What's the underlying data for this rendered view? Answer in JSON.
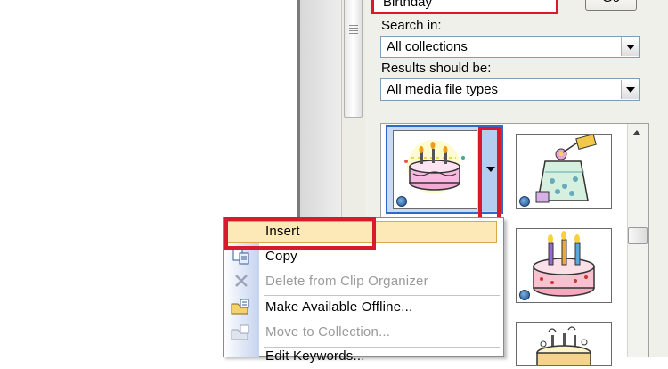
{
  "search": {
    "value": "Birthday",
    "go_label": "Go"
  },
  "search_in": {
    "label": "Search in:",
    "value": "All collections"
  },
  "results_type": {
    "label": "Results should be:",
    "value": "All media file types"
  },
  "context_menu": {
    "items": [
      {
        "label": "Insert",
        "enabled": true
      },
      {
        "label": "Copy",
        "enabled": true
      },
      {
        "label": "Delete from Clip Organizer",
        "enabled": false
      },
      {
        "label": "Make Available Offline...",
        "enabled": true
      },
      {
        "label": "Move to Collection...",
        "enabled": false
      },
      {
        "label": "Edit Keywords...",
        "enabled": true
      }
    ]
  },
  "clips": [
    {
      "name": "birthday-cake-clip",
      "icon": "cake-with-candles"
    },
    {
      "name": "gift-vase-clip",
      "icon": "gift-vase"
    },
    {
      "name": "pink-cake-clip",
      "icon": "pink-cake"
    },
    {
      "name": "party-cake-clip",
      "icon": "party-cake"
    }
  ],
  "colors": {
    "highlight_red": "#d81b2c",
    "menu_hover": "#fde9b8",
    "selection_blue": "#3169c6"
  }
}
